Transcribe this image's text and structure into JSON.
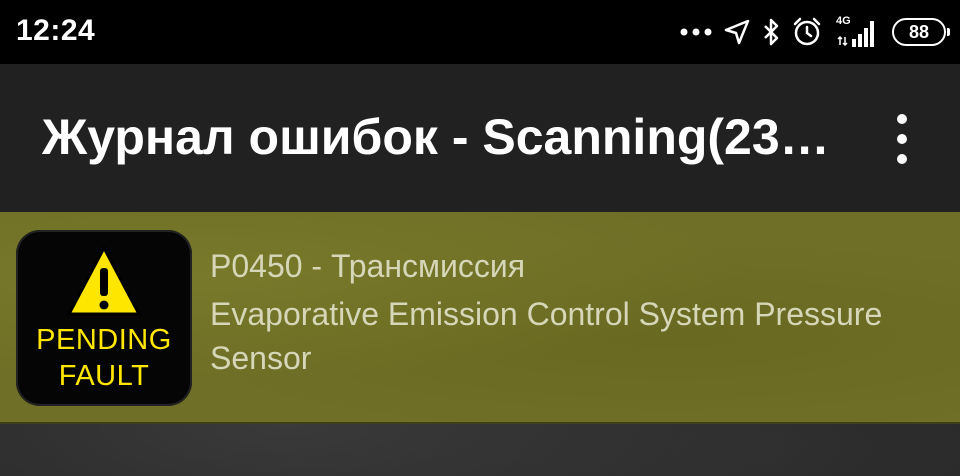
{
  "status_bar": {
    "time": "12:24",
    "network_type": "4G",
    "battery": "88",
    "icons": [
      "more-dots-icon",
      "location-arrow-icon",
      "bluetooth-icon",
      "alarm-clock-icon",
      "signal-icon",
      "battery-icon"
    ]
  },
  "app_bar": {
    "title": "Журнал ошибок - Scanning(23…",
    "menu_icon": "overflow-menu-icon"
  },
  "faults": [
    {
      "badge_line1": "PENDING",
      "badge_line2": "FAULT",
      "code_line": "P0450 - Трансмиссия",
      "description": "Evaporative Emission Control System Pressure Sensor",
      "icon": "warning-triangle-icon"
    }
  ],
  "colors": {
    "status_bar_bg": "#000000",
    "app_bar_bg": "#212121",
    "fault_row_bg": "#6f6f27",
    "badge_text": "#ffe600",
    "row_text": "#d6d6b8"
  }
}
